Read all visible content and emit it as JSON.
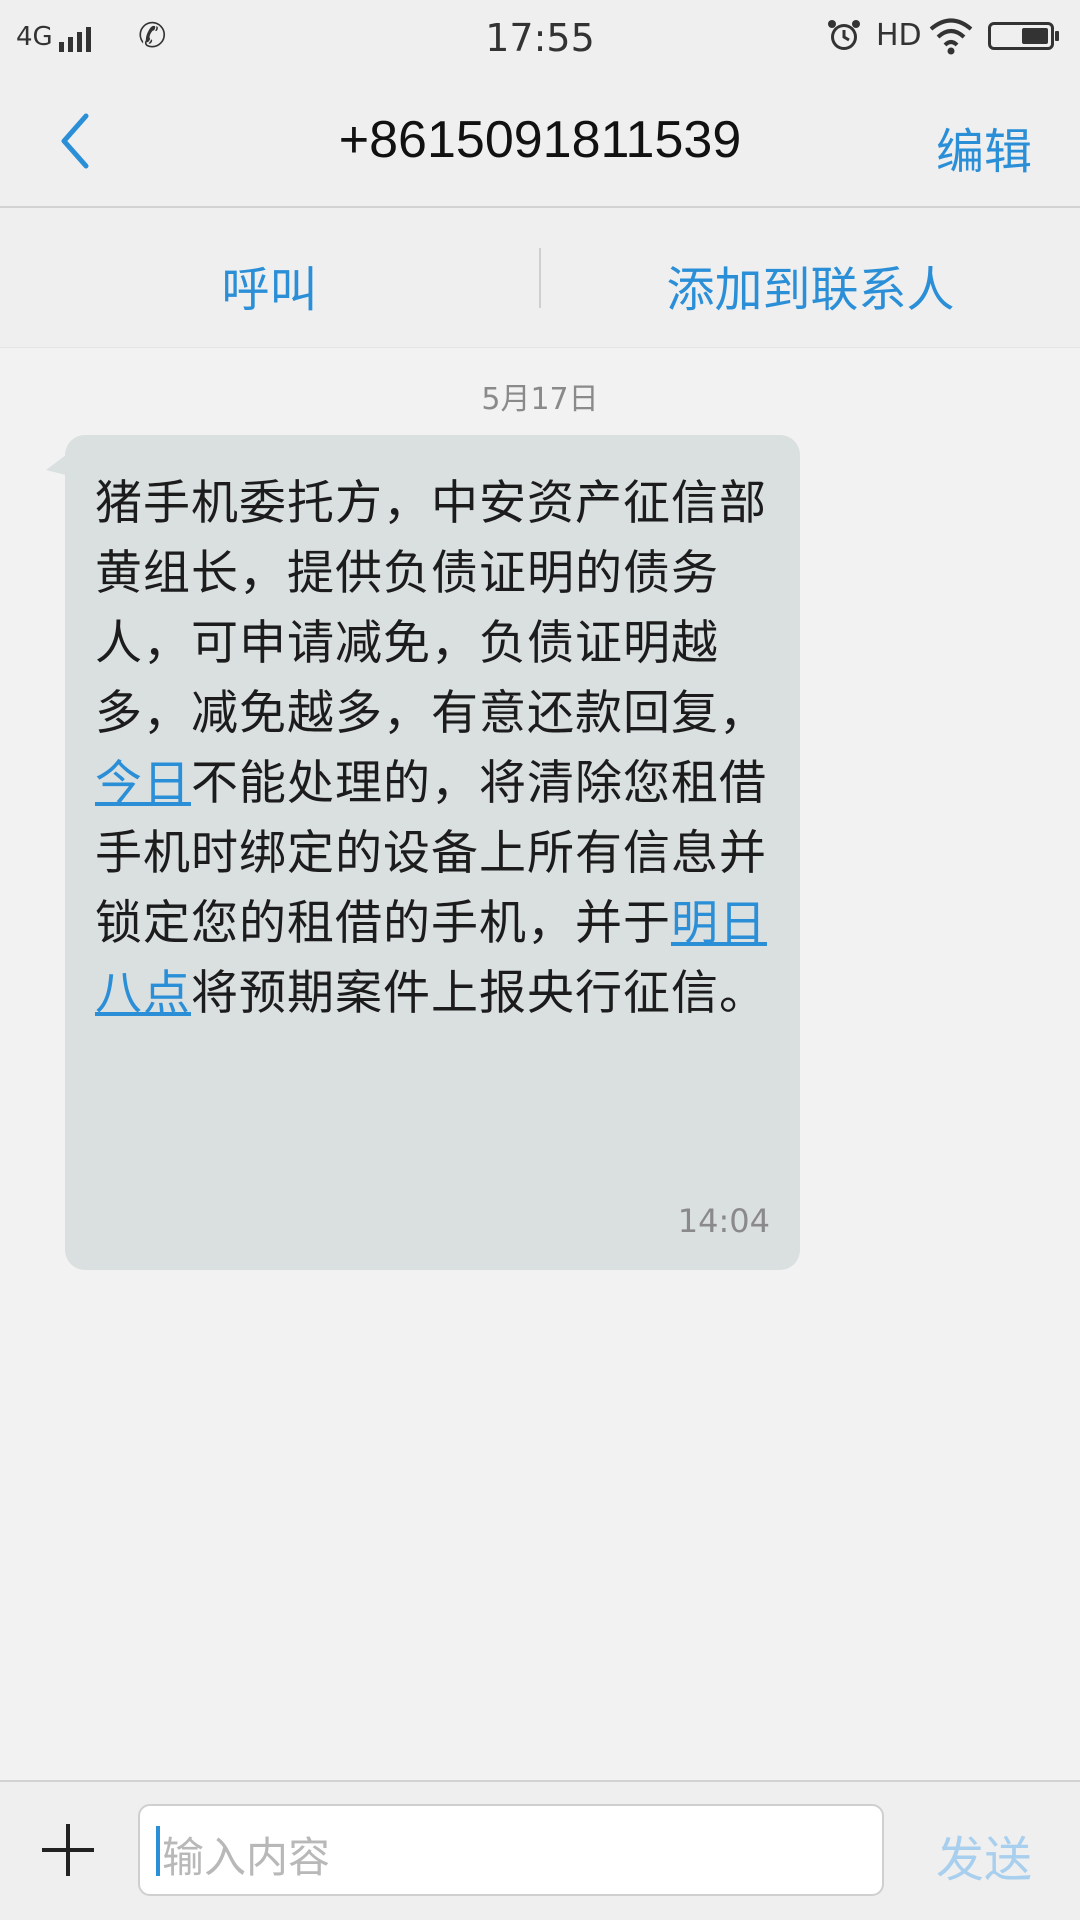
{
  "status_bar": {
    "network": "4G",
    "time": "17:55",
    "hd": "HD",
    "icons": [
      "signal-icon",
      "call-forward-icon",
      "alarm-icon",
      "wifi-icon",
      "battery-icon"
    ]
  },
  "header": {
    "title": "+8615091811539",
    "edit_label": "编辑",
    "back_icon": "chevron-left-icon"
  },
  "actions": {
    "call_label": "呼叫",
    "add_contact_label": "添加到联系人"
  },
  "conversation": {
    "date": "5月17日",
    "message": {
      "text_part1": "猪手机委托方，中安资产征信部黄组长，提供负债证明的债务人，可申请减免，负债证明越多，减免越多，有意还款回复，",
      "link1": "今日",
      "text_part2": "不能处理的，将清除您租借手机时绑定的设备上所有信息并锁定您的租借的手机，并于",
      "link2": "明日八点",
      "text_part3": "将预期案件上报央行征信。",
      "time": "14:04"
    }
  },
  "input_bar": {
    "placeholder": "输入内容",
    "send_label": "发送",
    "plus_icon": "plus-icon"
  },
  "colors": {
    "accent": "#2b8fd8",
    "bubble": "#dadfe0",
    "background": "#f2f2f2",
    "send_disabled": "#a9cfee"
  }
}
